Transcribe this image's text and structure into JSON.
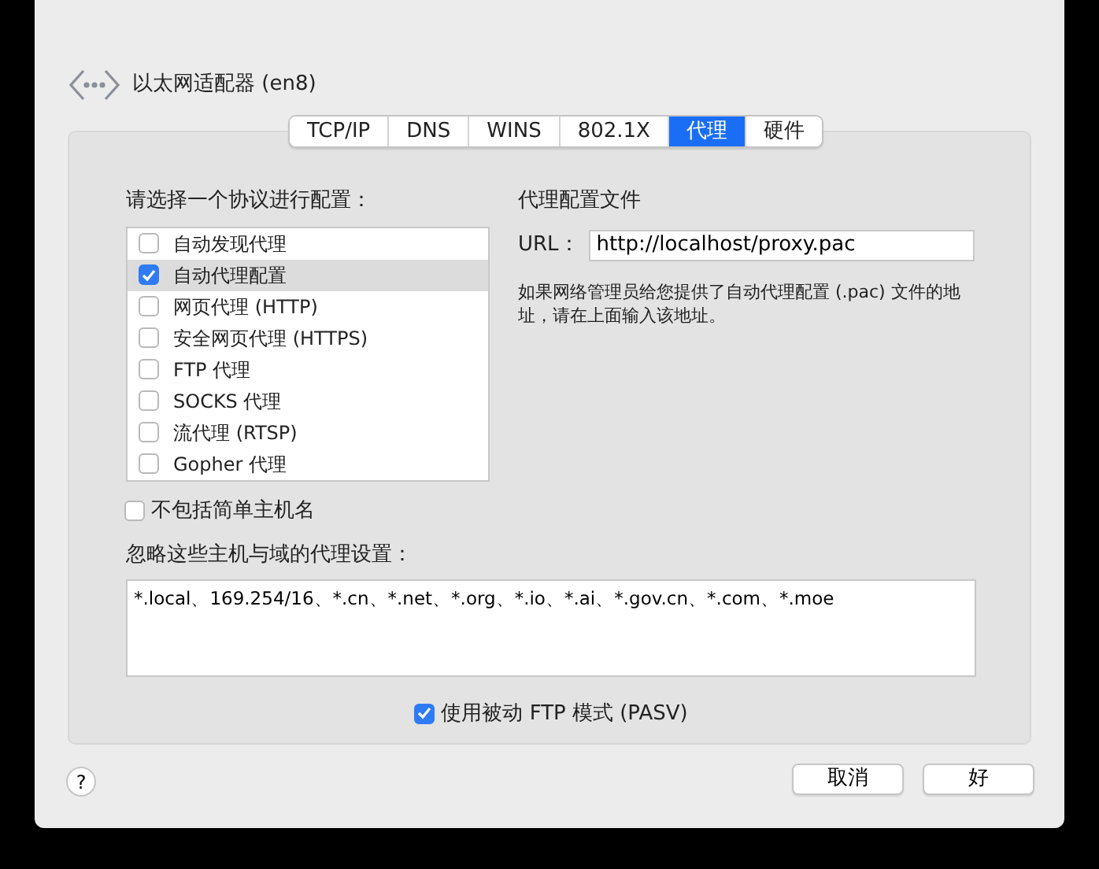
{
  "window": {
    "title": "以太网适配器 (en8)"
  },
  "tabs": [
    {
      "label": "TCP/IP",
      "selected": false
    },
    {
      "label": "DNS",
      "selected": false
    },
    {
      "label": "WINS",
      "selected": false
    },
    {
      "label": "802.1X",
      "selected": false
    },
    {
      "label": "代理",
      "selected": true
    },
    {
      "label": "硬件",
      "selected": false
    }
  ],
  "protocols": {
    "label": "请选择一个协议进行配置：",
    "items": [
      {
        "label": "自动发现代理",
        "checked": false,
        "selected": false
      },
      {
        "label": "自动代理配置",
        "checked": true,
        "selected": true
      },
      {
        "label": "网页代理 (HTTP)",
        "checked": false,
        "selected": false
      },
      {
        "label": "安全网页代理 (HTTPS)",
        "checked": false,
        "selected": false
      },
      {
        "label": "FTP 代理",
        "checked": false,
        "selected": false
      },
      {
        "label": "SOCKS 代理",
        "checked": false,
        "selected": false
      },
      {
        "label": "流代理 (RTSP)",
        "checked": false,
        "selected": false
      },
      {
        "label": "Gopher 代理",
        "checked": false,
        "selected": false
      }
    ]
  },
  "proxy_config": {
    "title": "代理配置文件",
    "url_label": "URL：",
    "url": "http://localhost/proxy.pac",
    "note": "如果网络管理员给您提供了自动代理配置 (.pac) 文件的地址，请在上面输入该地址。"
  },
  "exclude_simple": {
    "label": "不包括简单主机名",
    "checked": false
  },
  "bypass": {
    "label": "忽略这些主机与域的代理设置：",
    "value": "*.local、169.254/16、*.cn、*.net、*.org、*.io、*.ai、*.gov.cn、*.com、*.moe"
  },
  "passive_ftp": {
    "label": "使用被动 FTP 模式 (PASV)",
    "checked": true
  },
  "help": {
    "label": "?"
  },
  "buttons": [
    {
      "label": "取消"
    },
    {
      "label": "好"
    }
  ]
}
